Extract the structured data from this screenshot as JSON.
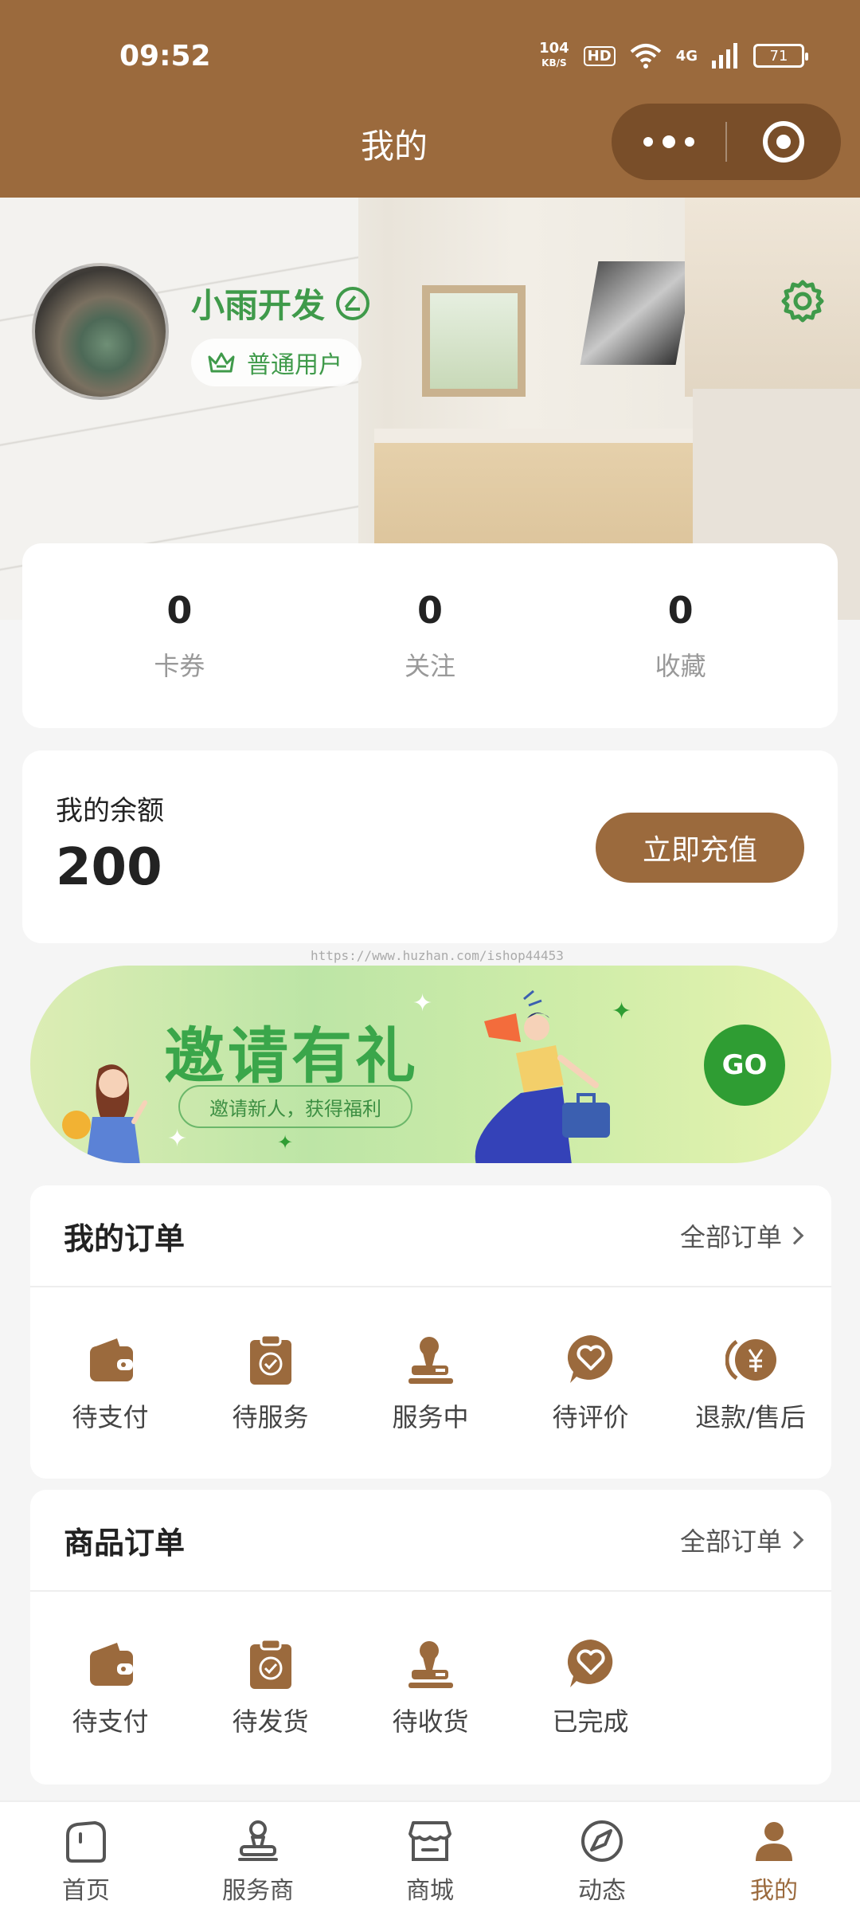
{
  "status_bar": {
    "time": "09:52",
    "net_speed_value": "104",
    "net_speed_unit": "KB/S",
    "hd": "HD",
    "signal": "4G",
    "battery": "71"
  },
  "nav": {
    "title": "我的"
  },
  "profile": {
    "username": "小雨开发",
    "member_level": "普通用户"
  },
  "stats": [
    {
      "value": "0",
      "label": "卡券"
    },
    {
      "value": "0",
      "label": "关注"
    },
    {
      "value": "0",
      "label": "收藏"
    }
  ],
  "balance": {
    "label": "我的余额",
    "value": "200",
    "button": "立即充值"
  },
  "watermark": "https://www.huzhan.com/ishop44453",
  "invite": {
    "title": "邀请有礼",
    "subtitle": "邀请新人，获得福利",
    "go": "GO"
  },
  "my_orders": {
    "title": "我的订单",
    "all": "全部订单",
    "items": [
      {
        "label": "待支付",
        "icon": "wallet-icon"
      },
      {
        "label": "待服务",
        "icon": "clipboard-check-icon"
      },
      {
        "label": "服务中",
        "icon": "stamp-icon"
      },
      {
        "label": "待评价",
        "icon": "heart-chat-icon"
      },
      {
        "label": "退款/售后",
        "icon": "refund-yen-icon"
      }
    ]
  },
  "goods_orders": {
    "title": "商品订单",
    "all": "全部订单",
    "items": [
      {
        "label": "待支付",
        "icon": "wallet-icon"
      },
      {
        "label": "待发货",
        "icon": "clipboard-check-icon"
      },
      {
        "label": "待收货",
        "icon": "stamp-icon"
      },
      {
        "label": "已完成",
        "icon": "heart-chat-icon"
      }
    ]
  },
  "tabbar": [
    {
      "label": "首页",
      "icon": "home-icon"
    },
    {
      "label": "服务商",
      "icon": "provider-icon"
    },
    {
      "label": "商城",
      "icon": "shop-icon"
    },
    {
      "label": "动态",
      "icon": "compass-icon"
    },
    {
      "label": "我的",
      "icon": "user-icon",
      "active": true
    }
  ],
  "colors": {
    "brand": "#9b6a3d",
    "accent_green": "#3f9a4a",
    "go_green": "#2f9d33",
    "background": "#f5f5f5"
  }
}
